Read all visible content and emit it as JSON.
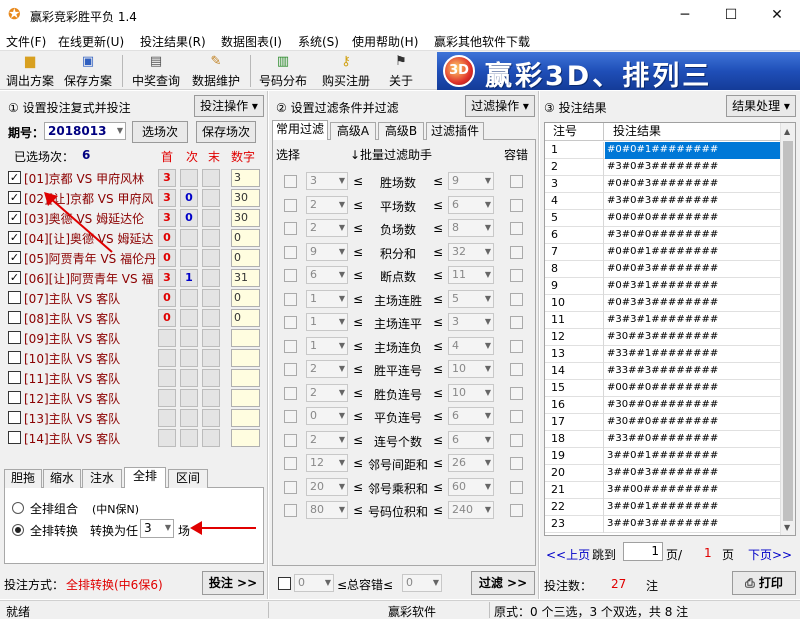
{
  "window": {
    "title": "赢彩竞彩胜平负 1.4",
    "min": "─",
    "max": "☐",
    "close": "✕"
  },
  "menu": [
    "文件(F)",
    "在线更新(U)",
    "投注结果(R)",
    "数据图表(I)",
    "系统(S)",
    "使用帮助(H)",
    "赢彩其他软件下载"
  ],
  "toolbar": [
    {
      "label": "调出方案",
      "icon": "folder-icon"
    },
    {
      "label": "保存方案",
      "icon": "save-icon"
    },
    {
      "label": "中奖查询",
      "icon": "query-icon"
    },
    {
      "label": "数据维护",
      "icon": "data-maintain-icon"
    },
    {
      "label": "号码分布",
      "icon": "chart-icon"
    },
    {
      "label": "购买注册",
      "icon": "key-icon"
    },
    {
      "label": "关于",
      "icon": "flag-icon"
    }
  ],
  "banner": {
    "text": "赢彩3D、排列三"
  },
  "left": {
    "header": "① 设置投注复式并投注",
    "op_button": "投注操作 ▾",
    "period_label": "期号：",
    "period_value": "2018013",
    "select_button": "选场次",
    "save_button": "保存场次",
    "selected_label": "已选场次：",
    "selected_count": "6",
    "col_first": "首",
    "col_second": "次",
    "col_last": "末",
    "col_number": "数字",
    "matches": [
      {
        "label": "[01]京都 VS 甲府风林",
        "checked": true,
        "first": "3",
        "second": "",
        "number": "3"
      },
      {
        "label": "[02][让]京都 VS 甲府风",
        "checked": true,
        "first": "3",
        "second": "0",
        "number": "30"
      },
      {
        "label": "[03]奥德 VS 姆延达伦",
        "checked": true,
        "first": "3",
        "second": "0",
        "number": "30"
      },
      {
        "label": "[04][让]奥德 VS 姆延达",
        "checked": true,
        "first": "0",
        "second": "",
        "number": "0"
      },
      {
        "label": "[05]阿贾青年 VS 福伦丹",
        "checked": true,
        "first": "0",
        "second": "",
        "number": "0"
      },
      {
        "label": "[06][让]阿贾青年 VS 福",
        "checked": true,
        "first": "3",
        "second": "1",
        "number": "31"
      },
      {
        "label": "[07]主队 VS 客队",
        "checked": false,
        "first": "0",
        "second": "",
        "number": "0"
      },
      {
        "label": "[08]主队 VS 客队",
        "checked": false,
        "first": "0",
        "second": "",
        "number": "0"
      },
      {
        "label": "[09]主队 VS 客队",
        "checked": false,
        "first": "",
        "second": "",
        "number": ""
      },
      {
        "label": "[10]主队 VS 客队",
        "checked": false,
        "first": "",
        "second": "",
        "number": ""
      },
      {
        "label": "[11]主队 VS 客队",
        "checked": false,
        "first": "",
        "second": "",
        "number": ""
      },
      {
        "label": "[12]主队 VS 客队",
        "checked": false,
        "first": "",
        "second": "",
        "number": ""
      },
      {
        "label": "[13]主队 VS 客队",
        "checked": false,
        "first": "",
        "second": "",
        "number": ""
      },
      {
        "label": "[14]主队 VS 客队",
        "checked": false,
        "first": "",
        "second": "",
        "number": ""
      }
    ],
    "tabs": [
      "胆拖",
      "缩水",
      "注水",
      "全排",
      "区间"
    ],
    "active_tab": "全排",
    "radio1": "全排组合",
    "radio1_note": "(中N保N)",
    "radio2": "全排转换",
    "convert_label": "转换为任",
    "convert_value": "3",
    "convert_unit": "场",
    "bet_method_label": "投注方式：",
    "bet_method_value": "全排转换(中6保6)",
    "bet_button": "投注 >>"
  },
  "middle": {
    "header": "② 设置过滤条件并过滤",
    "op_button": "过滤操作 ▾",
    "tabs": [
      "常用过滤",
      "高级A",
      "高级B",
      "过滤插件"
    ],
    "active_tab": "常用过滤",
    "col_select": "选择",
    "col_helper": "↓批量过滤助手",
    "col_tolerance": "容错",
    "filters": [
      {
        "min": "3",
        "name": "胜场数",
        "max": "9"
      },
      {
        "min": "2",
        "name": "平场数",
        "max": "6"
      },
      {
        "min": "2",
        "name": "负场数",
        "max": "8"
      },
      {
        "min": "9",
        "name": "积分和",
        "max": "32"
      },
      {
        "min": "6",
        "name": "断点数",
        "max": "11"
      },
      {
        "min": "1",
        "name": "主场连胜",
        "max": "5"
      },
      {
        "min": "1",
        "name": "主场连平",
        "max": "3"
      },
      {
        "min": "1",
        "name": "主场连负",
        "max": "4"
      },
      {
        "min": "2",
        "name": "胜平连号",
        "max": "10"
      },
      {
        "min": "2",
        "name": "胜负连号",
        "max": "10"
      },
      {
        "min": "0",
        "name": "平负连号",
        "max": "6"
      },
      {
        "min": "2",
        "name": "连号个数",
        "max": "6"
      },
      {
        "min": "12",
        "name": "邻号间距和",
        "max": "26"
      },
      {
        "min": "20",
        "name": "邻号乘积和",
        "max": "60"
      },
      {
        "min": "80",
        "name": "号码位积和",
        "max": "240"
      }
    ],
    "sym": "≤",
    "total_min": "0",
    "total_label": "≤总容错≤",
    "total_max": "0",
    "filter_button": "过滤 >>"
  },
  "right": {
    "header": "③ 投注结果",
    "op_button": "结果处理 ▾",
    "col_no": "注号",
    "col_result": "投注结果",
    "rows": [
      [
        "1",
        "#0#0#1########"
      ],
      [
        "2",
        "#3#0#3########"
      ],
      [
        "3",
        "#0#0#3########"
      ],
      [
        "4",
        "#3#0#3########"
      ],
      [
        "5",
        "#0#0#0########"
      ],
      [
        "6",
        "#3#0#0########"
      ],
      [
        "7",
        "#0#0#1########"
      ],
      [
        "8",
        "#0#0#3########"
      ],
      [
        "9",
        "#0#3#1########"
      ],
      [
        "10",
        "#0#3#3########"
      ],
      [
        "11",
        "#3#3#1########"
      ],
      [
        "12",
        "#30##3########"
      ],
      [
        "13",
        "#33##1########"
      ],
      [
        "14",
        "#33##3########"
      ],
      [
        "15",
        "#00##0########"
      ],
      [
        "16",
        "#30##0########"
      ],
      [
        "17",
        "#30##0########"
      ],
      [
        "18",
        "#33##0########"
      ],
      [
        "19",
        "3##0#1########"
      ],
      [
        "20",
        "3##0#3########"
      ],
      [
        "21",
        "3##00#########"
      ],
      [
        "22",
        "3##0#1########"
      ],
      [
        "23",
        "3##0#3########"
      ]
    ],
    "prev": "<<上页",
    "jump_label": "跳到",
    "page_value": "1",
    "page_sep": "页/",
    "total_pages": "1",
    "page_unit": "页",
    "next": "下页>>",
    "count_label": "投注数：",
    "count_value": "27",
    "count_unit": "注",
    "print_button": "打印"
  },
  "status": {
    "left": "就绪",
    "center": "赢彩软件",
    "right": "原式：0 个三选，3 个双选，共 8 注"
  }
}
